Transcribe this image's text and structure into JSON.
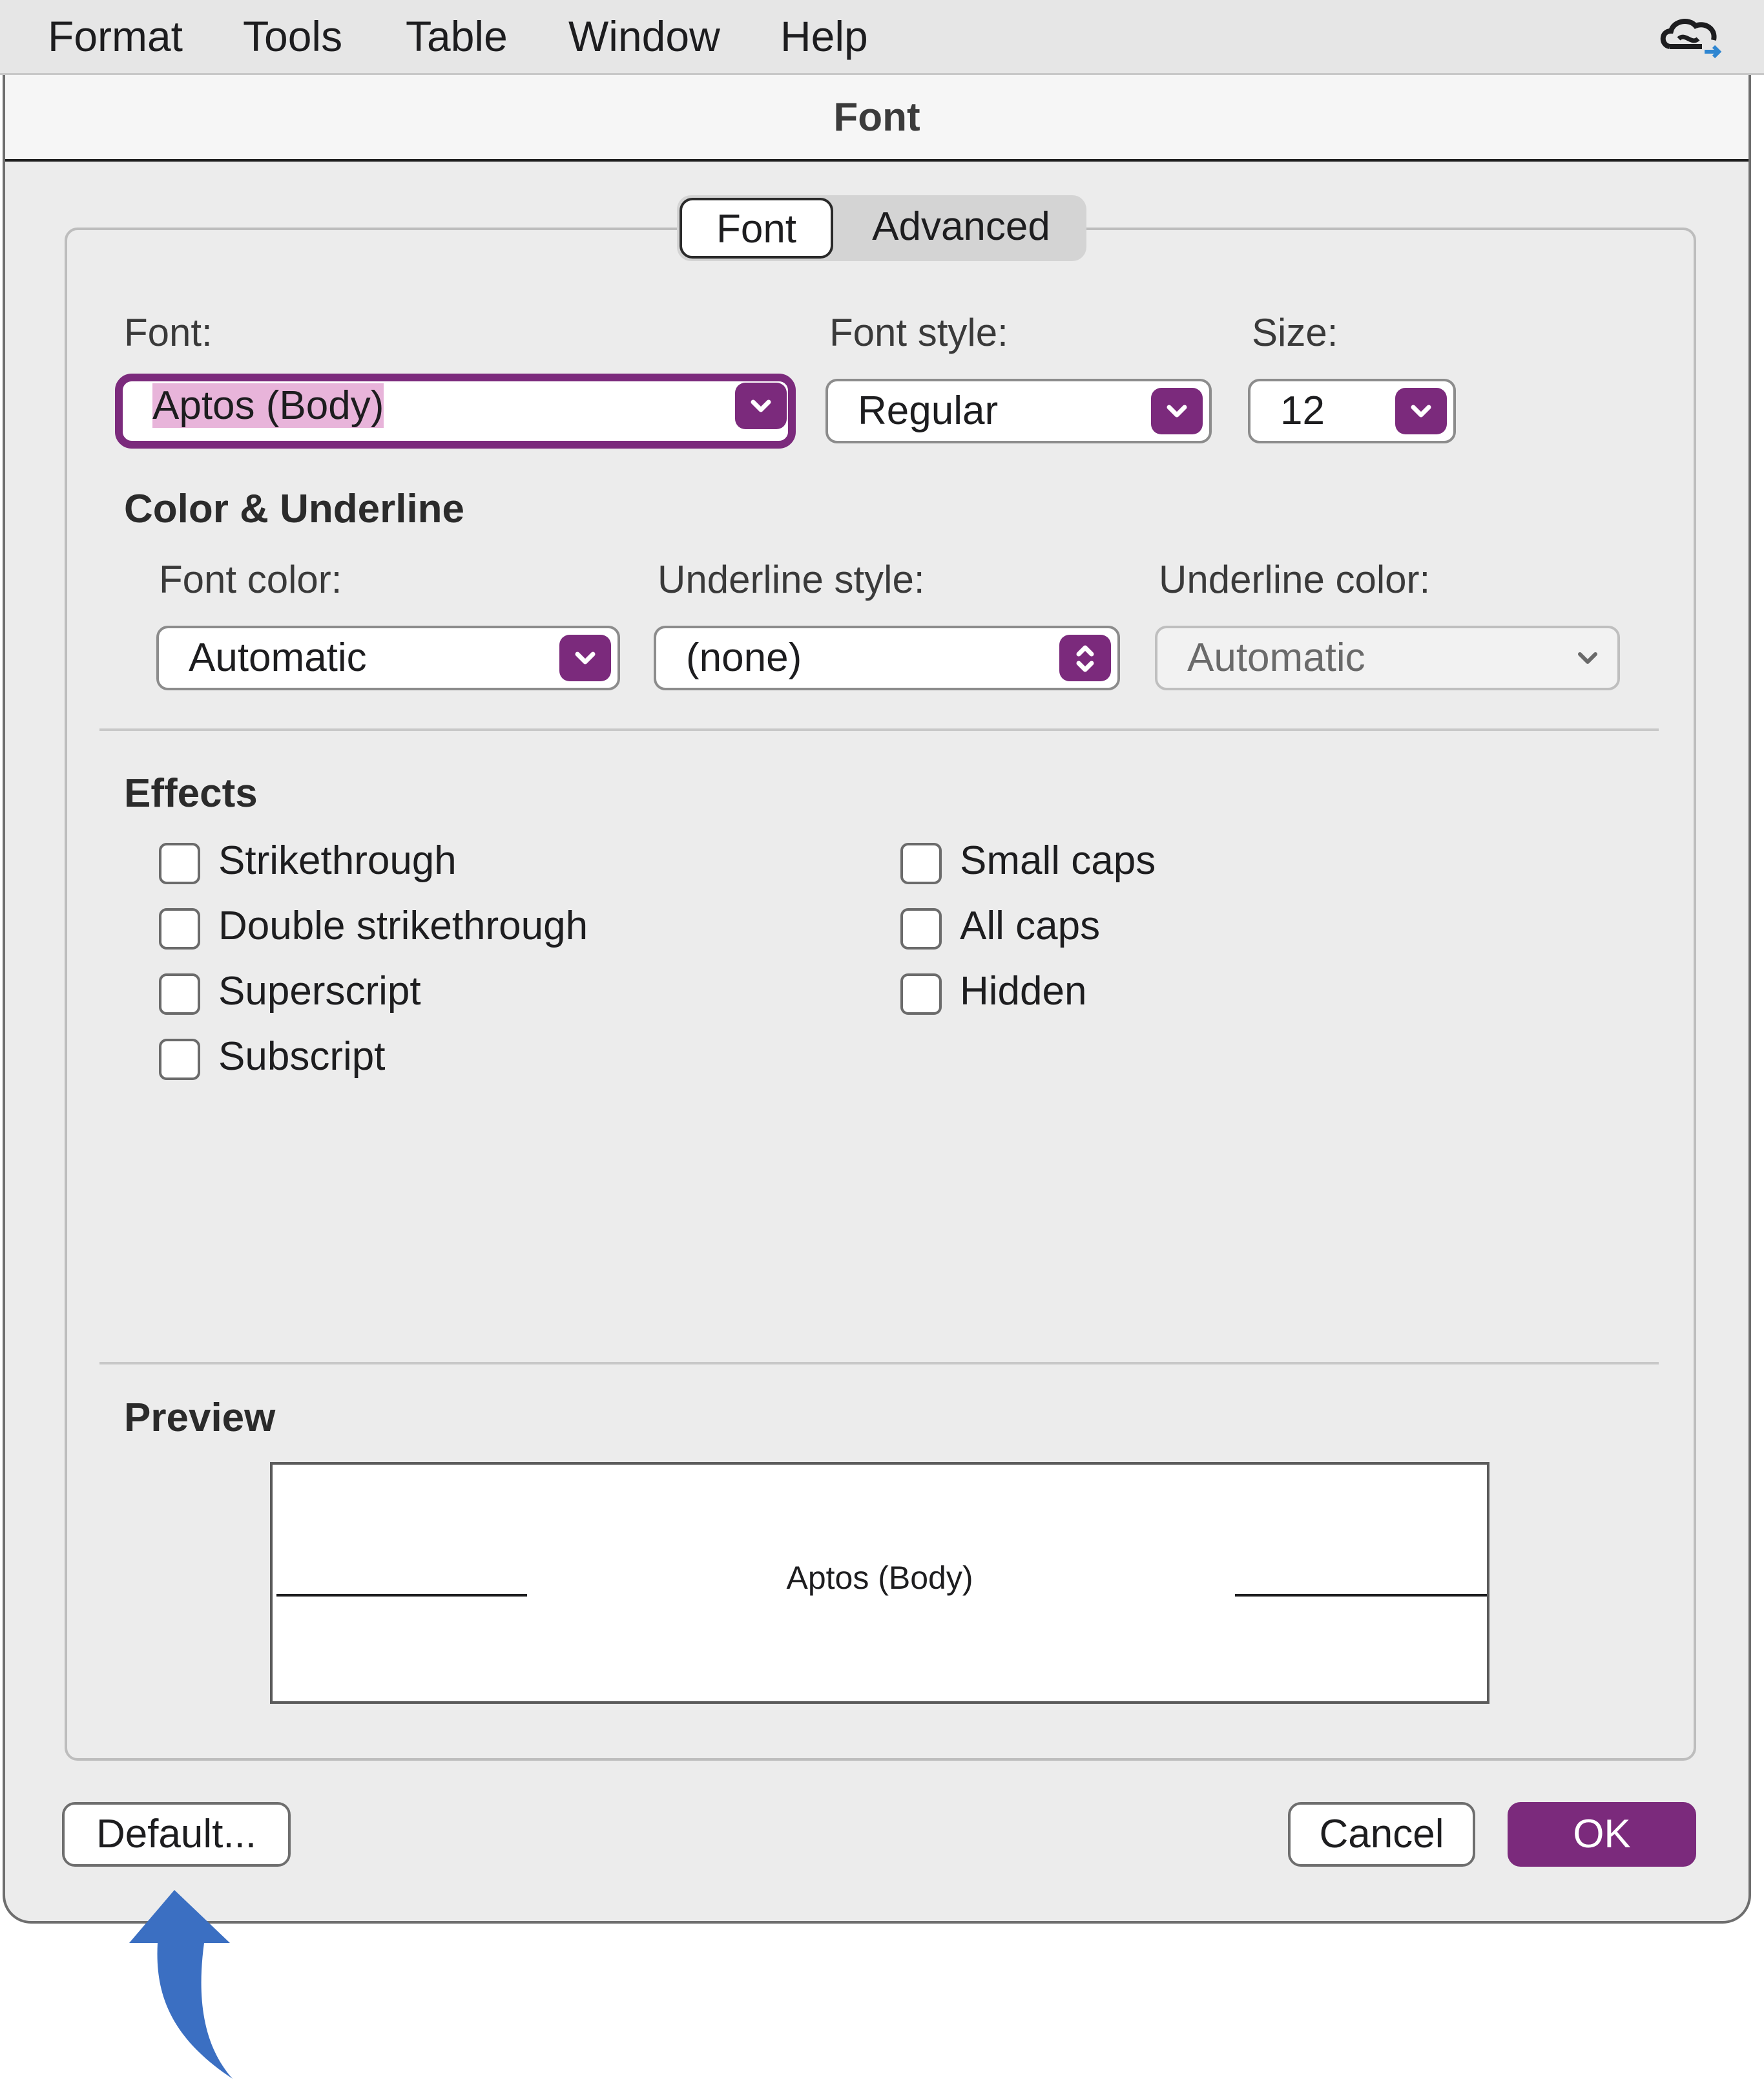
{
  "menubar": {
    "items": [
      "Format",
      "Tools",
      "Table",
      "Window",
      "Help"
    ],
    "right_icon": "creative-cloud-sync-icon"
  },
  "dialog": {
    "title": "Font",
    "tabs": [
      {
        "label": "Font",
        "selected": true
      },
      {
        "label": "Advanced",
        "selected": false
      }
    ],
    "font": {
      "label": "Font:",
      "value": "Aptos (Body)"
    },
    "font_style": {
      "label": "Font style:",
      "value": "Regular"
    },
    "size": {
      "label": "Size:",
      "value": "12"
    },
    "color_underline": {
      "heading": "Color & Underline",
      "font_color": {
        "label": "Font color:",
        "value": "Automatic"
      },
      "underline_style": {
        "label": "Underline style:",
        "value": "(none)"
      },
      "underline_color": {
        "label": "Underline color:",
        "value": "Automatic",
        "enabled": false
      }
    },
    "effects": {
      "heading": "Effects",
      "left": [
        {
          "label": "Strikethrough",
          "checked": false
        },
        {
          "label": "Double strikethrough",
          "checked": false
        },
        {
          "label": "Superscript",
          "checked": false
        },
        {
          "label": "Subscript",
          "checked": false
        }
      ],
      "right": [
        {
          "label": "Small caps",
          "checked": false
        },
        {
          "label": "All caps",
          "checked": false
        },
        {
          "label": "Hidden",
          "checked": false
        }
      ]
    },
    "preview": {
      "heading": "Preview",
      "sample_text": "Aptos (Body)"
    },
    "buttons": {
      "default": "Default...",
      "cancel": "Cancel",
      "ok": "OK"
    }
  },
  "colors": {
    "accent": "#7b2a7c",
    "highlight": "#e8b4da",
    "annotation_arrow": "#3b6fc2"
  }
}
